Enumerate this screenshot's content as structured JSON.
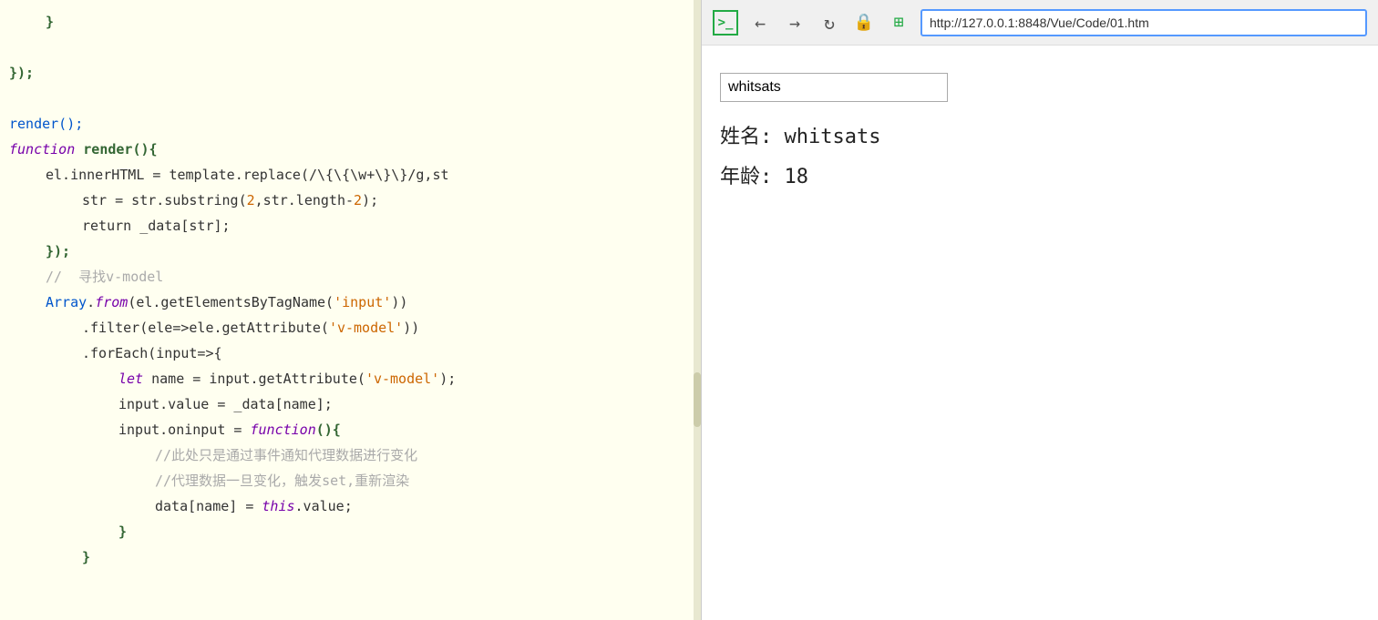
{
  "code_panel": {
    "lines": [
      {
        "id": "l1",
        "indent": "indent-1",
        "tokens": [
          {
            "text": "}",
            "class": "c-brace"
          }
        ]
      },
      {
        "id": "l2",
        "indent": "",
        "tokens": []
      },
      {
        "id": "l3",
        "indent": "",
        "tokens": [
          {
            "text": "});",
            "class": "c-brace"
          }
        ]
      },
      {
        "id": "l4",
        "indent": "",
        "tokens": []
      },
      {
        "id": "l5",
        "indent": "",
        "tokens": [
          {
            "text": "render();",
            "class": "c-function"
          }
        ]
      },
      {
        "id": "l6",
        "indent": "",
        "tokens": [
          {
            "text": "function",
            "class": "c-keyword"
          },
          {
            "text": " render(){",
            "class": "c-brace"
          }
        ]
      },
      {
        "id": "l7",
        "indent": "indent-1",
        "tokens": [
          {
            "text": "el.innerHTML = template.replace(/\\{\\{\\w+\\}\\}/g,st",
            "class": "c-variable"
          }
        ]
      },
      {
        "id": "l8",
        "indent": "indent-2",
        "tokens": [
          {
            "text": "str = str.substring(",
            "class": "c-variable"
          },
          {
            "text": "2",
            "class": "c-number"
          },
          {
            "text": ",str.length-",
            "class": "c-variable"
          },
          {
            "text": "2",
            "class": "c-number"
          },
          {
            "text": ");",
            "class": "c-variable"
          }
        ]
      },
      {
        "id": "l9",
        "indent": "indent-2",
        "tokens": [
          {
            "text": "return _data[str];",
            "class": "c-variable"
          }
        ]
      },
      {
        "id": "l10",
        "indent": "indent-1",
        "tokens": [
          {
            "text": "});",
            "class": "c-brace"
          }
        ]
      },
      {
        "id": "l11",
        "indent": "indent-1",
        "tokens": [
          {
            "text": "//  寻找v-model",
            "class": "c-comment"
          }
        ]
      },
      {
        "id": "l12",
        "indent": "indent-1",
        "tokens": [
          {
            "text": "Array",
            "class": "c-function"
          },
          {
            "text": ".",
            "class": "c-operator"
          },
          {
            "text": "from",
            "class": "c-keyword"
          },
          {
            "text": "(el.getElementsByTagName(",
            "class": "c-variable"
          },
          {
            "text": "'input'",
            "class": "c-string"
          },
          {
            "text": "))",
            "class": "c-variable"
          }
        ]
      },
      {
        "id": "l13",
        "indent": "indent-2",
        "tokens": [
          {
            "text": ".filter(ele=>ele.getAttribute(",
            "class": "c-variable"
          },
          {
            "text": "'v-model'",
            "class": "c-string"
          },
          {
            "text": "))",
            "class": "c-variable"
          }
        ]
      },
      {
        "id": "l14",
        "indent": "indent-2",
        "tokens": [
          {
            "text": ".forEach(input=>{",
            "class": "c-variable"
          }
        ]
      },
      {
        "id": "l15",
        "indent": "indent-3",
        "tokens": [
          {
            "text": "let",
            "class": "c-keyword"
          },
          {
            "text": " name = input.getAttribute(",
            "class": "c-variable"
          },
          {
            "text": "'v-model'",
            "class": "c-string"
          },
          {
            "text": ");",
            "class": "c-variable"
          }
        ]
      },
      {
        "id": "l16",
        "indent": "indent-3",
        "tokens": [
          {
            "text": "input.value = _data[name];",
            "class": "c-variable"
          }
        ]
      },
      {
        "id": "l17",
        "indent": "indent-3",
        "tokens": [
          {
            "text": "input.oninput = ",
            "class": "c-variable"
          },
          {
            "text": "function",
            "class": "c-keyword"
          },
          {
            "text": "(){",
            "class": "c-brace"
          }
        ]
      },
      {
        "id": "l18",
        "indent": "indent-4",
        "tokens": [
          {
            "text": "//此处只是通过事件通知代理数据进行变化",
            "class": "c-comment"
          }
        ]
      },
      {
        "id": "l19",
        "indent": "indent-4",
        "tokens": [
          {
            "text": "//代理数据一旦变化，触发set,重新渲染",
            "class": "c-comment"
          }
        ]
      },
      {
        "id": "l20",
        "indent": "indent-4",
        "tokens": [
          {
            "text": "data[name] = ",
            "class": "c-variable"
          },
          {
            "text": "this",
            "class": "c-keyword"
          },
          {
            "text": ".value;",
            "class": "c-variable"
          }
        ]
      },
      {
        "id": "l21",
        "indent": "indent-3",
        "tokens": [
          {
            "text": "}",
            "class": "c-brace"
          }
        ]
      },
      {
        "id": "l22",
        "indent": "indent-2",
        "tokens": [
          {
            "text": "}",
            "class": "c-brace"
          }
        ]
      }
    ]
  },
  "browser": {
    "address": "http://127.0.0.1:8848/Vue/Code/01.htm",
    "preview": {
      "input_value": "whitsats",
      "name_label": "姓名: whitsats",
      "age_label": "年龄: 18"
    },
    "toolbar": {
      "terminal_icon": ">_",
      "back_icon": "←",
      "forward_icon": "→",
      "refresh_icon": "↻",
      "lock_icon": "🔒",
      "grid_icon": "⊞"
    }
  }
}
